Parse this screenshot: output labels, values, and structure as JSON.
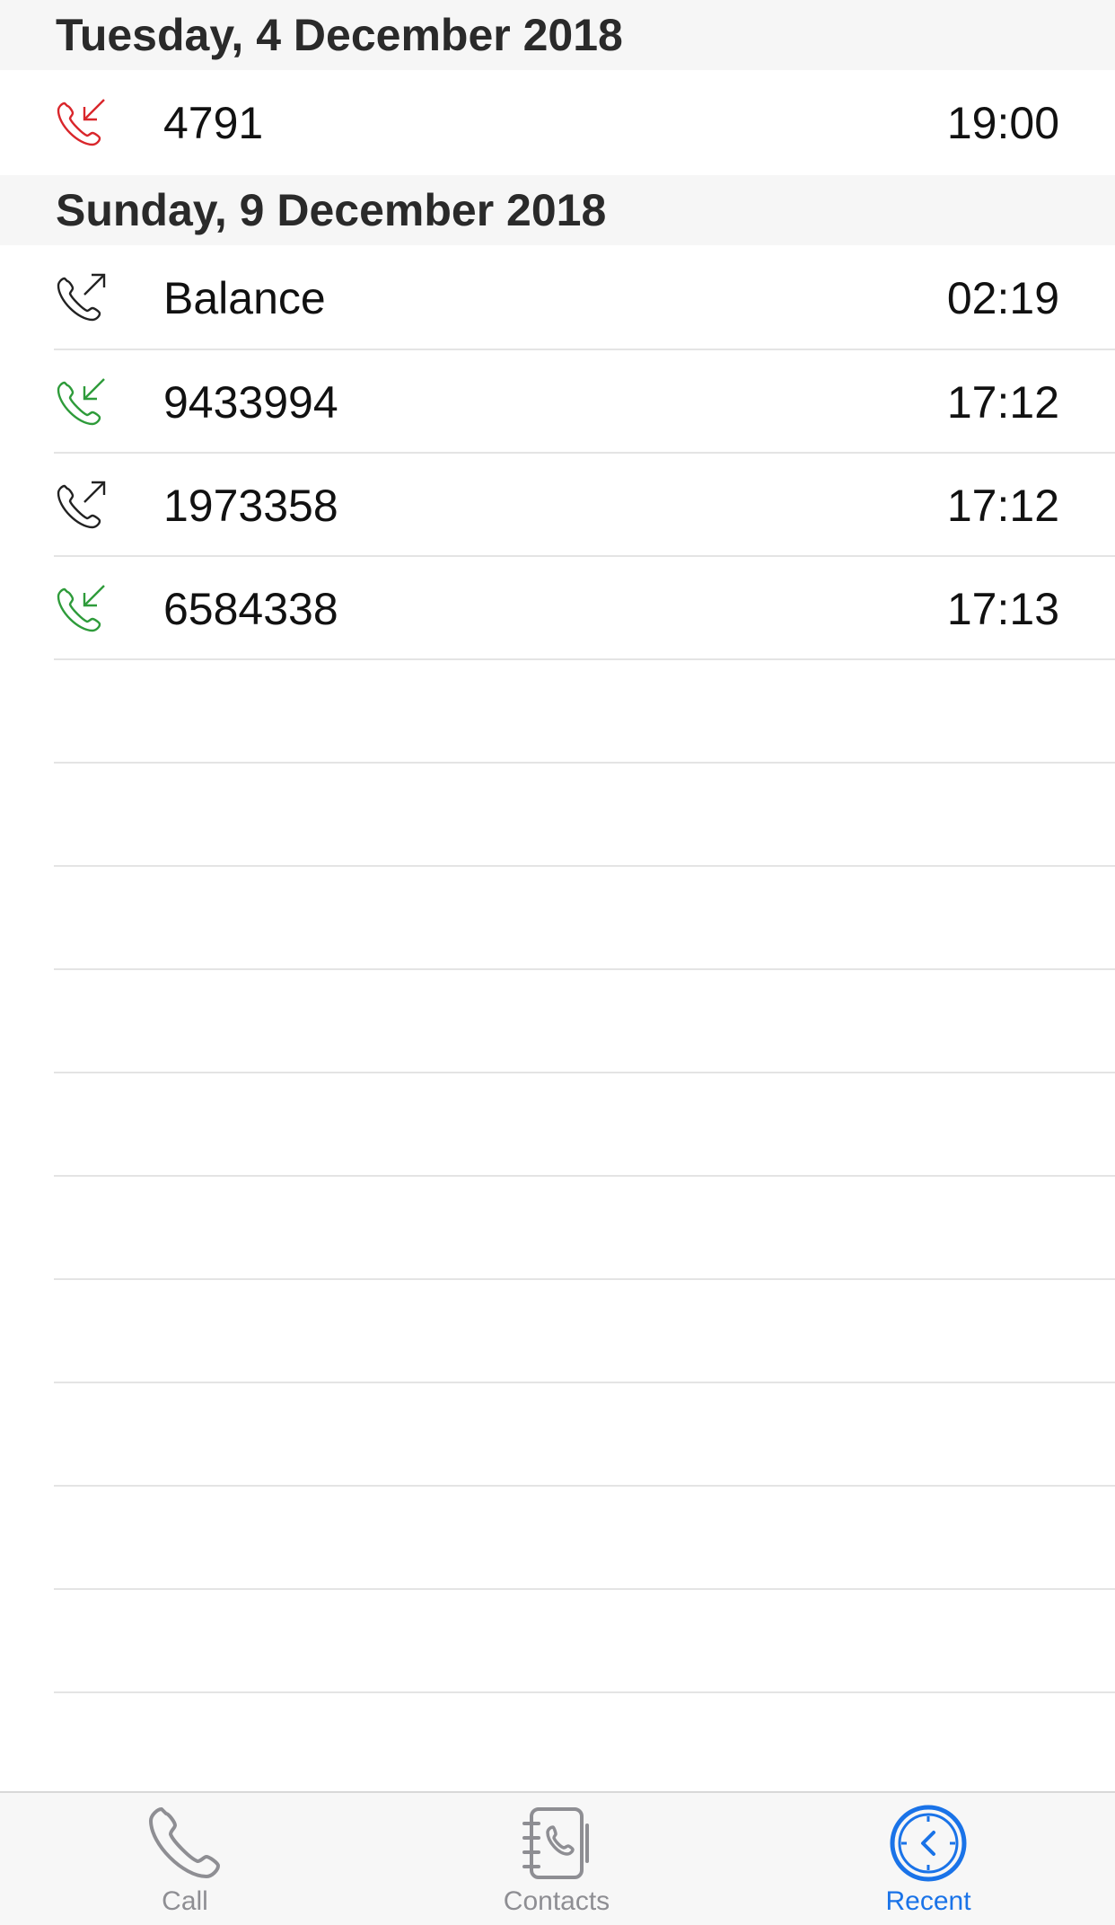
{
  "colors": {
    "missed": "#d9262b",
    "incoming": "#2e9b3a",
    "outgoing": "#222222",
    "active_tab": "#1a73e8",
    "inactive_tab": "#8e8e93"
  },
  "sections": [
    {
      "date": "Tuesday, 4 December 2018",
      "calls": [
        {
          "type": "missed",
          "icon": "phone-missed-icon",
          "name": "4791",
          "time": "19:00"
        }
      ]
    },
    {
      "date": "Sunday, 9 December 2018",
      "calls": [
        {
          "type": "outgoing",
          "icon": "phone-outgoing-icon",
          "name": "Balance",
          "time": "02:19"
        },
        {
          "type": "incoming",
          "icon": "phone-incoming-icon",
          "name": "9433994",
          "time": "17:12"
        },
        {
          "type": "outgoing",
          "icon": "phone-outgoing-icon",
          "name": "1973358",
          "time": "17:12"
        },
        {
          "type": "incoming",
          "icon": "phone-incoming-icon",
          "name": "6584338",
          "time": "17:13"
        }
      ]
    }
  ],
  "tabbar": {
    "tabs": [
      {
        "label": "Call",
        "icon": "phone-icon",
        "active": false
      },
      {
        "label": "Contacts",
        "icon": "contacts-book-icon",
        "active": false
      },
      {
        "label": "Recent",
        "icon": "clock-icon",
        "active": true
      }
    ]
  }
}
